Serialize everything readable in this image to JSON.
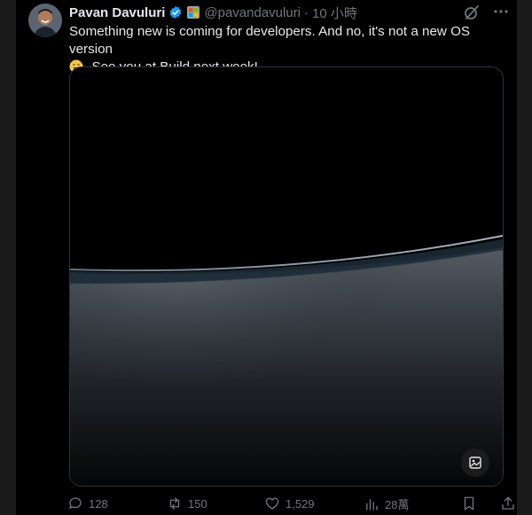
{
  "tweet": {
    "author": {
      "display_name": "Pavan Davuluri",
      "handle": "@pavandavuluri",
      "time": "10 小時"
    },
    "separator": "·",
    "text_line1": "Something new is coming for developers. And no, it's not a new OS version",
    "text_line2": ". See you at Build next week!",
    "actions": {
      "replies": "128",
      "reposts": "150",
      "likes": "1,529",
      "views": "28萬"
    }
  },
  "icons": {
    "verified": "verified-badge-icon",
    "affiliate": "affiliate-badge-icon",
    "grok": "grok-icon",
    "emoji": "grinning-sweat-emoji-icon",
    "alt": "image-description-icon",
    "reply": "reply-icon",
    "repost": "repost-icon",
    "like": "heart-icon",
    "views": "views-icon",
    "bookmark": "bookmark-icon",
    "share": "share-icon"
  },
  "colors": {
    "background": "#000000",
    "text": "#e7e9ea",
    "muted": "#71767b",
    "verified": "#1d9bf0"
  }
}
